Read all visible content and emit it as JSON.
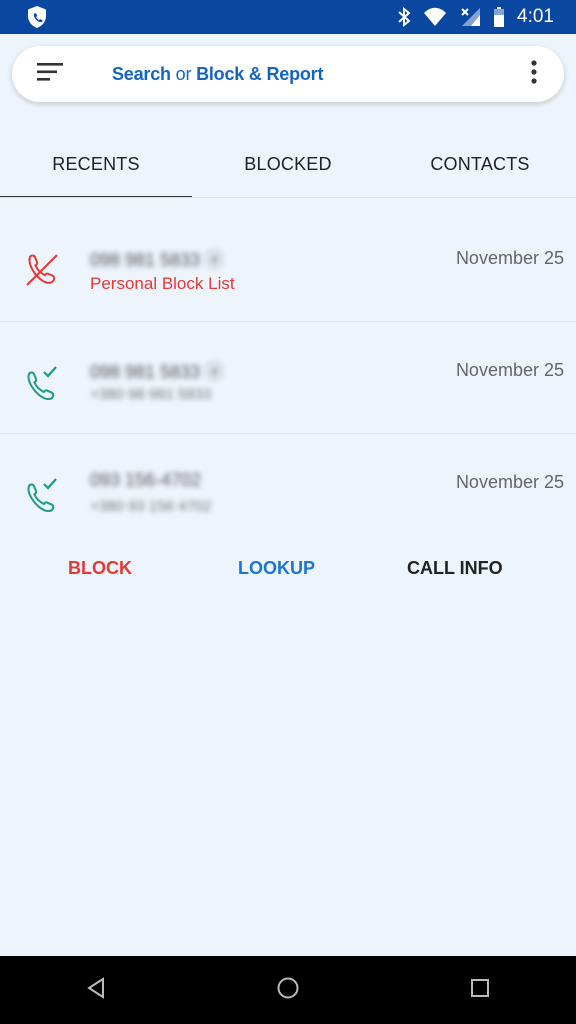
{
  "status_bar": {
    "time": "4:01",
    "icons": [
      "shield-icon",
      "bluetooth-icon",
      "wifi-icon",
      "signal-icon",
      "battery-icon"
    ]
  },
  "search": {
    "part1": "Search",
    "part2": " or ",
    "part3": "Block & Report",
    "menu_icon": "menu-icon",
    "more_icon": "more-vert-icon"
  },
  "tabs": [
    {
      "label": "RECENTS",
      "active": true
    },
    {
      "label": "BLOCKED",
      "active": false
    },
    {
      "label": "CONTACTS",
      "active": false
    }
  ],
  "calls": [
    {
      "number": "098 981 5833 ⓐ",
      "sub": "Personal Block List",
      "date": "November 25",
      "type": "blocked"
    },
    {
      "number": "098 981 5833 ⓐ",
      "sub": "+380 98 981 5833",
      "date": "November 25",
      "type": "incoming"
    },
    {
      "number": "093 156-4702",
      "sub": "+380 93 156 4702",
      "date": "November 25",
      "type": "incoming"
    }
  ],
  "actions": {
    "block": "BLOCK",
    "lookup": "LOOKUP",
    "call_info": "CALL INFO"
  },
  "colors": {
    "status_bar": "#0a47a0",
    "accent_blue": "#1565c0",
    "red": "#e53935",
    "green": "#1e9a85",
    "background": "#eef4fc"
  }
}
